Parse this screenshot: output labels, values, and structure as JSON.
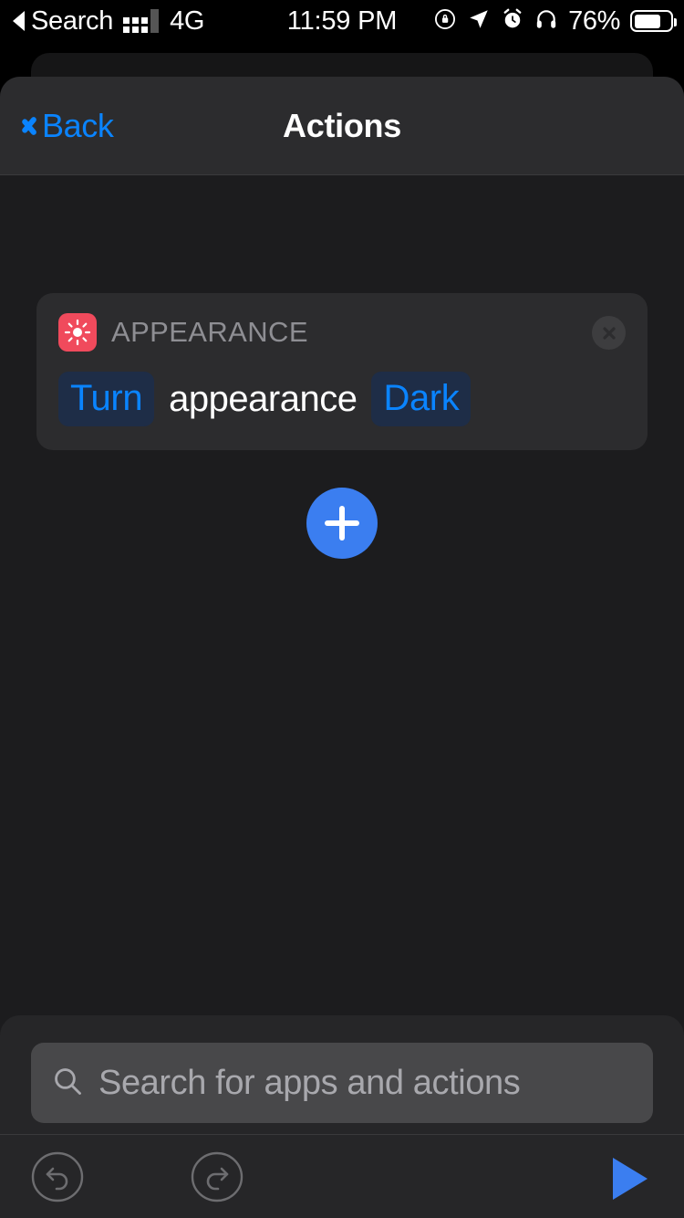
{
  "status_bar": {
    "back_label": "Search",
    "back_icon": "back-triangle-icon",
    "signal_icon": "cellular-signal-icon",
    "carrier": "4G",
    "time": "11:59 PM",
    "orientation_lock_icon": "rotation-lock-icon",
    "location_icon": "location-arrow-icon",
    "alarm_icon": "alarm-clock-icon",
    "headphones_icon": "headphones-icon",
    "battery_percent": "76%",
    "battery_icon": "battery-icon"
  },
  "navbar": {
    "back_label": "Back",
    "back_icon": "chevron-left-icon",
    "title": "Actions"
  },
  "action_card": {
    "app_icon": "brightness-sun-icon",
    "app_name": "APPEARANCE",
    "close_icon": "close-x-icon",
    "statement": [
      {
        "kind": "token",
        "text": "Turn"
      },
      {
        "kind": "plain",
        "text": "appearance"
      },
      {
        "kind": "token",
        "text": "Dark"
      }
    ]
  },
  "add_button": {
    "icon": "plus-icon",
    "label": "+"
  },
  "search": {
    "icon": "search-icon",
    "placeholder": "Search for apps and actions",
    "value": ""
  },
  "toolbar": {
    "undo_icon": "undo-icon",
    "redo_icon": "redo-icon",
    "run_icon": "play-icon"
  },
  "colors": {
    "accent_blue": "#0a84ff",
    "add_button_blue": "#3b7ef0",
    "app_icon_red": "#f04a5c",
    "background": "#1c1c1e",
    "card": "#2c2c2e",
    "token_bg": "#1e2d47",
    "secondary_text": "#8e8e93"
  }
}
